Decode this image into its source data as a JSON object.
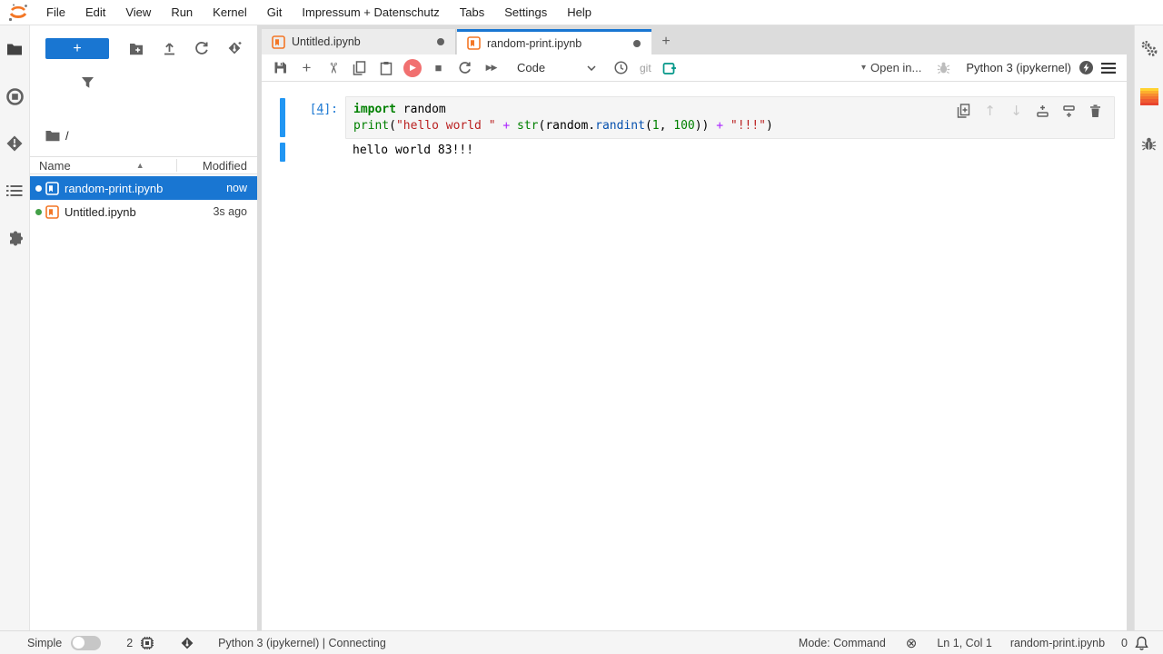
{
  "menubar": {
    "items": [
      "File",
      "Edit",
      "View",
      "Run",
      "Kernel",
      "Git",
      "Impressum + Datenschutz",
      "Tabs",
      "Settings",
      "Help"
    ]
  },
  "left_sidebar": {
    "icons": [
      "file-browser",
      "running-sessions",
      "git",
      "table-of-contents",
      "extension-manager"
    ]
  },
  "file_browser": {
    "new_launcher_label": "+",
    "toolbar_icons": [
      "new-folder",
      "upload",
      "refresh",
      "git-clone"
    ],
    "breadcrumb_root": "/",
    "columns": {
      "name": "Name",
      "modified": "Modified"
    },
    "sort_indicator": "▲",
    "files": [
      {
        "name": "random-print.ipynb",
        "modified": "now",
        "selected": true,
        "dot_color": "#ffffff"
      },
      {
        "name": "Untitled.ipynb",
        "modified": "3s ago",
        "selected": false,
        "dot_color": "#43a047"
      }
    ]
  },
  "tabs": [
    {
      "label": "Untitled.ipynb",
      "active": false
    },
    {
      "label": "random-print.ipynb",
      "active": true
    }
  ],
  "new_tab_label": "+",
  "notebook_toolbar": {
    "cell_type": "Code",
    "git_label": "git",
    "open_in_label": "Open in...",
    "kernel_name": "Python 3 (ipykernel)",
    "run_glyph": "▶",
    "stop_glyph": "■",
    "fast_forward_glyph": "▶▶",
    "caret_glyph": "▾",
    "add_glyph": "+",
    "cut_glyph": "✂"
  },
  "cell": {
    "prompt_open": "[",
    "prompt_num": "4",
    "prompt_close": "]:",
    "code_lines": [
      [
        {
          "t": "import",
          "c": "kw"
        },
        {
          "t": " random",
          "c": "pl"
        }
      ],
      [
        {
          "t": "print",
          "c": "bi"
        },
        {
          "t": "(",
          "c": "pl"
        },
        {
          "t": "\"hello world \"",
          "c": "st"
        },
        {
          "t": " ",
          "c": "pl"
        },
        {
          "t": "+",
          "c": "op"
        },
        {
          "t": " ",
          "c": "pl"
        },
        {
          "t": "str",
          "c": "bi"
        },
        {
          "t": "(random.",
          "c": "pl"
        },
        {
          "t": "randint",
          "c": "pr"
        },
        {
          "t": "(",
          "c": "pl"
        },
        {
          "t": "1",
          "c": "nu"
        },
        {
          "t": ", ",
          "c": "pl"
        },
        {
          "t": "100",
          "c": "nu"
        },
        {
          "t": "))",
          "c": "pl"
        },
        {
          "t": " ",
          "c": "pl"
        },
        {
          "t": "+",
          "c": "op"
        },
        {
          "t": " ",
          "c": "pl"
        },
        {
          "t": "\"!!!\"",
          "c": "st"
        },
        {
          "t": ")",
          "c": "pl"
        }
      ]
    ],
    "output": "hello world 83!!!",
    "action_icons": [
      "duplicate-cell",
      "move-cell-up",
      "move-cell-down",
      "insert-cell-above",
      "insert-cell-below",
      "delete-cell"
    ],
    "move_up_glyph": "↑",
    "move_down_glyph": "↓"
  },
  "right_sidebar": {
    "icons": [
      "property-inspector-gears",
      "colormap-swatch",
      "debugger-bug"
    ]
  },
  "status_bar": {
    "simple_label": "Simple",
    "kernel_count": "2",
    "kernel_status": "Python 3 (ipykernel) | Connecting",
    "mode": "Mode: Command",
    "trust_glyph": "⊗",
    "line_col": "Ln 1, Col 1",
    "filename": "random-print.ipynb",
    "notification_count": "0"
  },
  "colors": {
    "accent_blue": "#1976d2",
    "collapser_blue": "#2196f3",
    "run_red": "#f17070",
    "jupyter_orange": "#f37726",
    "teal": "#009688",
    "green_dot": "#43a047",
    "code_keyword": "#008000",
    "code_string": "#ba2121",
    "code_operator": "#aa22ff",
    "code_property": "#0550ae"
  }
}
